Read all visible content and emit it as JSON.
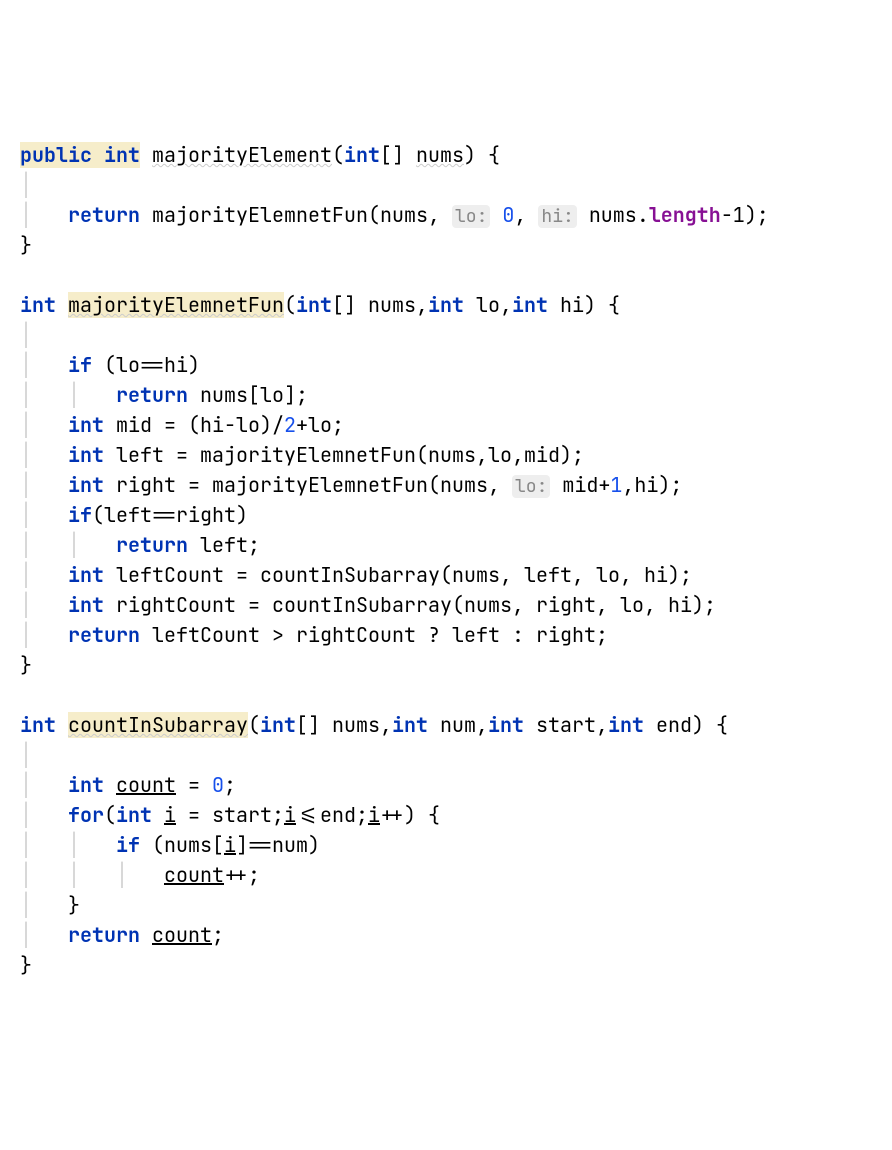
{
  "code": {
    "kw_public": "public",
    "kw_int": "int",
    "kw_return": "return",
    "kw_if": "if",
    "kw_for": "for",
    "fn1_name": "majorityElement",
    "fn1_param_type": "int",
    "fn1_param_name": "nums",
    "fn1_call": "majorityElemnetFun",
    "fn1_arg_nums": "nums",
    "hint_lo": "lo:",
    "fn1_arg0": "0",
    "hint_hi": "hi:",
    "fn1_arg_len": "nums",
    "length_field": "length",
    "minus1": "-1",
    "fn2_name": "majorityElemnetFun",
    "fn2_p1": "nums",
    "fn2_p2": "lo",
    "fn2_p3": "hi",
    "cond1": "(lo==hi)",
    "ret_numslo": "nums[lo];",
    "mid_decl": "mid = (hi-lo)/",
    "two": "2",
    "mid_tail": "+lo;",
    "left_decl": "left = majorityElemnetFun(nums,lo,mid);",
    "right_decl_a": "right = majorityElemnetFun(nums,",
    "right_decl_b": "mid+",
    "one": "1",
    "right_decl_c": ",hi);",
    "cond2": "(left==right)",
    "ret_left": "left;",
    "leftcount": "leftCount = countInSubarray(nums, left, lo, hi);",
    "rightcount": "rightCount = countInSubarray(nums, right, lo, hi);",
    "ret_tern": "leftCount > rightCount ? left : right;",
    "fn3_name": "countInSubarray",
    "fn3_p1": "nums",
    "fn3_p2": "num",
    "fn3_p3": "start",
    "fn3_p4": "end",
    "count_var": "count",
    "eq0": " = ",
    "zero": "0",
    "semi": ";",
    "for_open": "(",
    "i_var": "i",
    "eq_start": " = start;",
    "i_le_end": "<=end;",
    "i_incr": "++) {",
    "if_nums_i": "(nums[",
    "eq_num": "]==num)",
    "count_pp": "++;",
    "ret_count_pre": " "
  }
}
